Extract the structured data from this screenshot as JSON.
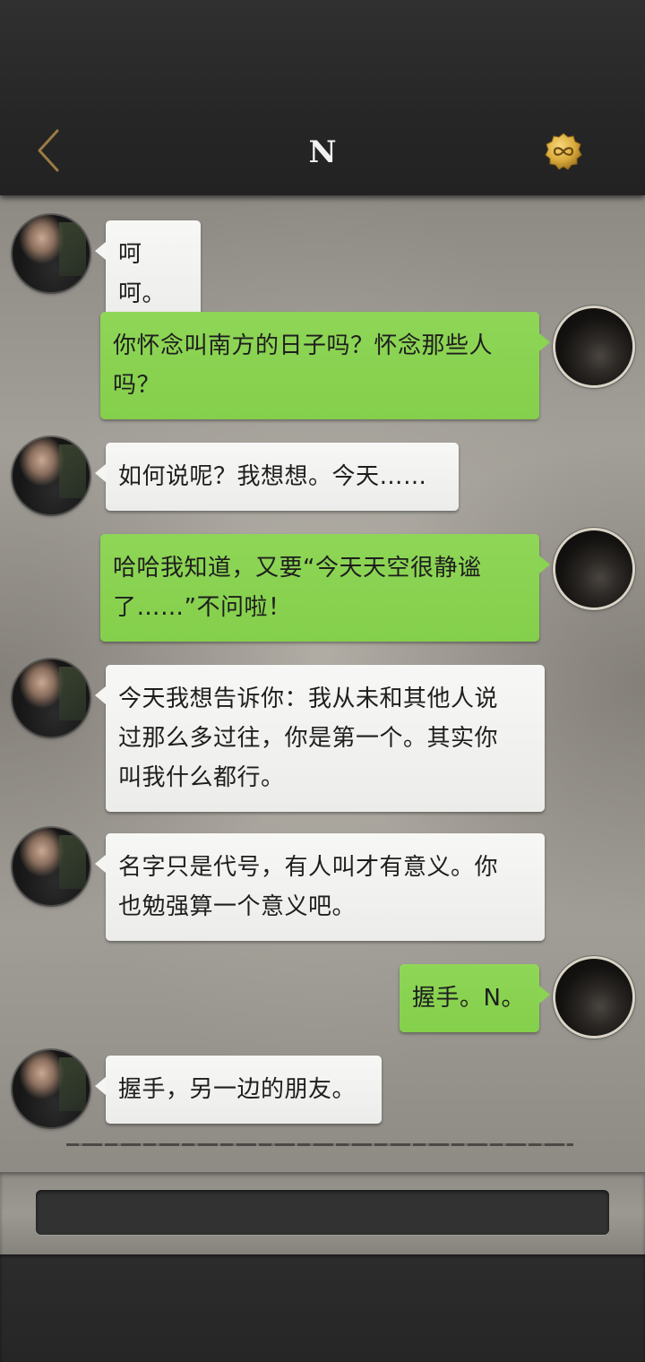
{
  "header": {
    "title": "N",
    "back_icon": "chevron-left-icon",
    "badge_icon": "infinity-coin-icon",
    "colors": {
      "back_chevron": "#9b7b45",
      "coin": "#d9a93a"
    }
  },
  "messages": [
    {
      "side": "left",
      "text": "呵呵。"
    },
    {
      "side": "right",
      "text": "你怀念叫南方的日子吗？怀念那些人\n吗？"
    },
    {
      "side": "left",
      "text": "如何说呢？我想想。今天……"
    },
    {
      "side": "right",
      "text": "哈哈我知道，又要“今天天空很静谧\n了……”不问啦！"
    },
    {
      "side": "left",
      "text": "今天我想告诉你：我从未和其他人说\n过那么多过往，你是第一个。其实你\n叫我什么都行。"
    },
    {
      "side": "left",
      "text": "名字只是代号，有人叫才有意义。你\n也勉强算一个意义吧。"
    },
    {
      "side": "right",
      "text": "握手。N。"
    },
    {
      "side": "left",
      "text": "握手，另一边的朋友。"
    }
  ],
  "input": {
    "value": "",
    "placeholder": ""
  },
  "colors": {
    "bubble_right": "#8bd352",
    "bubble_left": "#f5f5f3",
    "paper": "#a4a19a",
    "header_bg": "#262626"
  }
}
